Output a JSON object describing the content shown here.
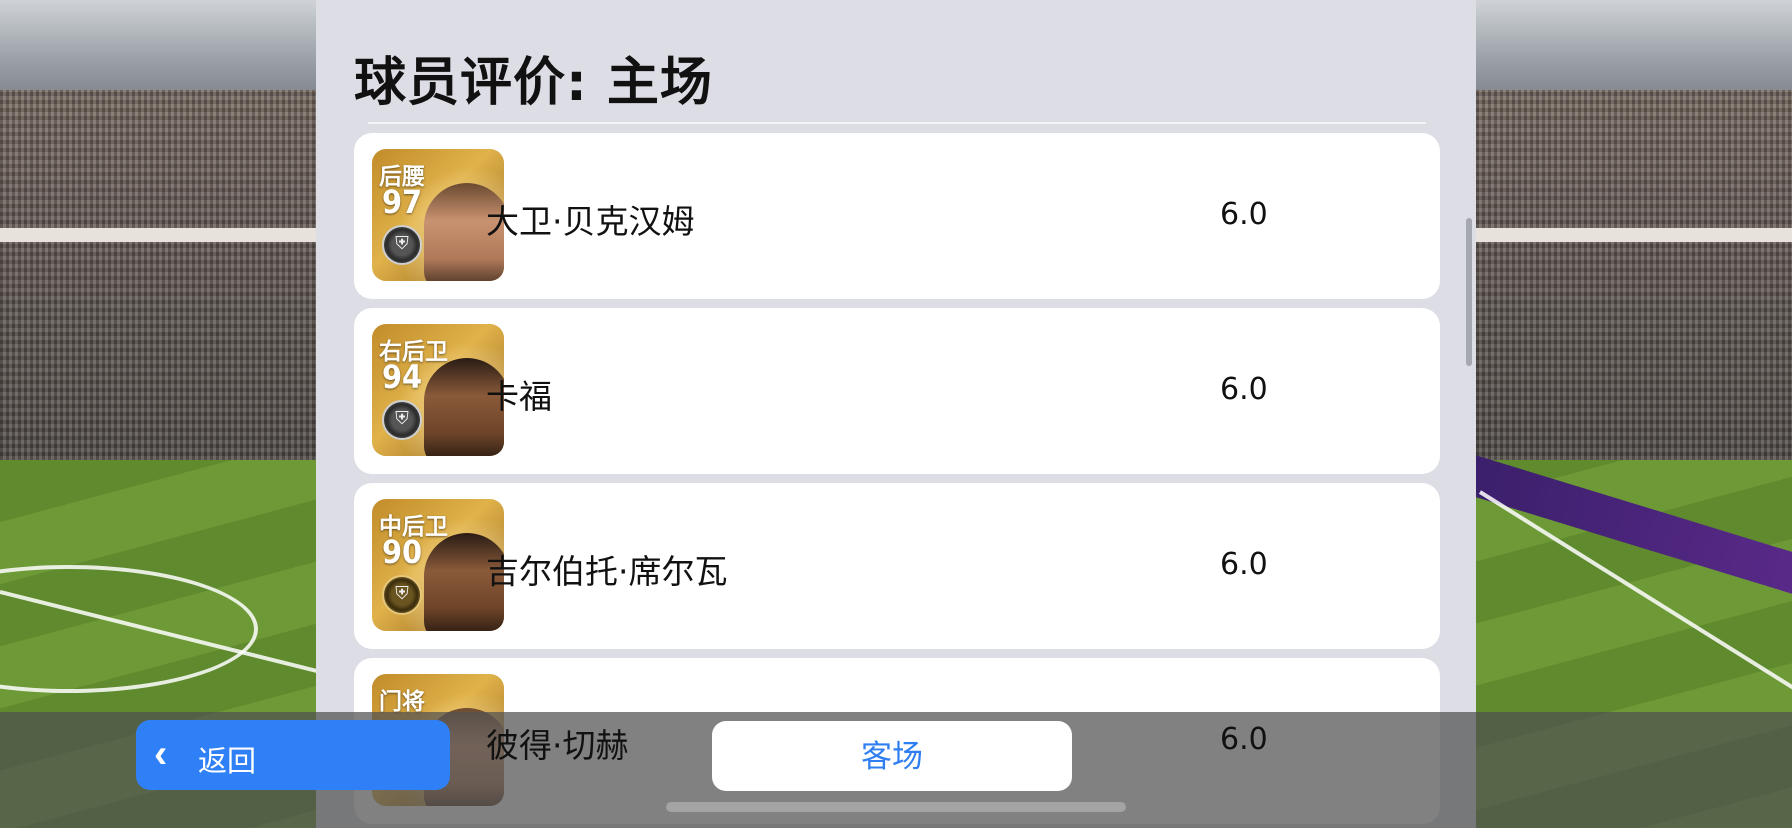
{
  "title": "球员评价: 主场",
  "players": [
    {
      "position": "后腰",
      "overall": "97",
      "name": "大卫·贝克汉姆",
      "rating": "6.0"
    },
    {
      "position": "右后卫",
      "overall": "94",
      "name": "卡福",
      "rating": "6.0"
    },
    {
      "position": "中后卫",
      "overall": "90",
      "name": "吉尔伯托·席尔瓦",
      "rating": "6.0"
    },
    {
      "position": "门将",
      "overall": "",
      "name": "彼得·切赫",
      "rating": "6.0"
    }
  ],
  "buttons": {
    "back_label": "返回",
    "away_label": "客场"
  },
  "colors": {
    "accent": "#2f80f6",
    "panel": "#dcdde5"
  }
}
